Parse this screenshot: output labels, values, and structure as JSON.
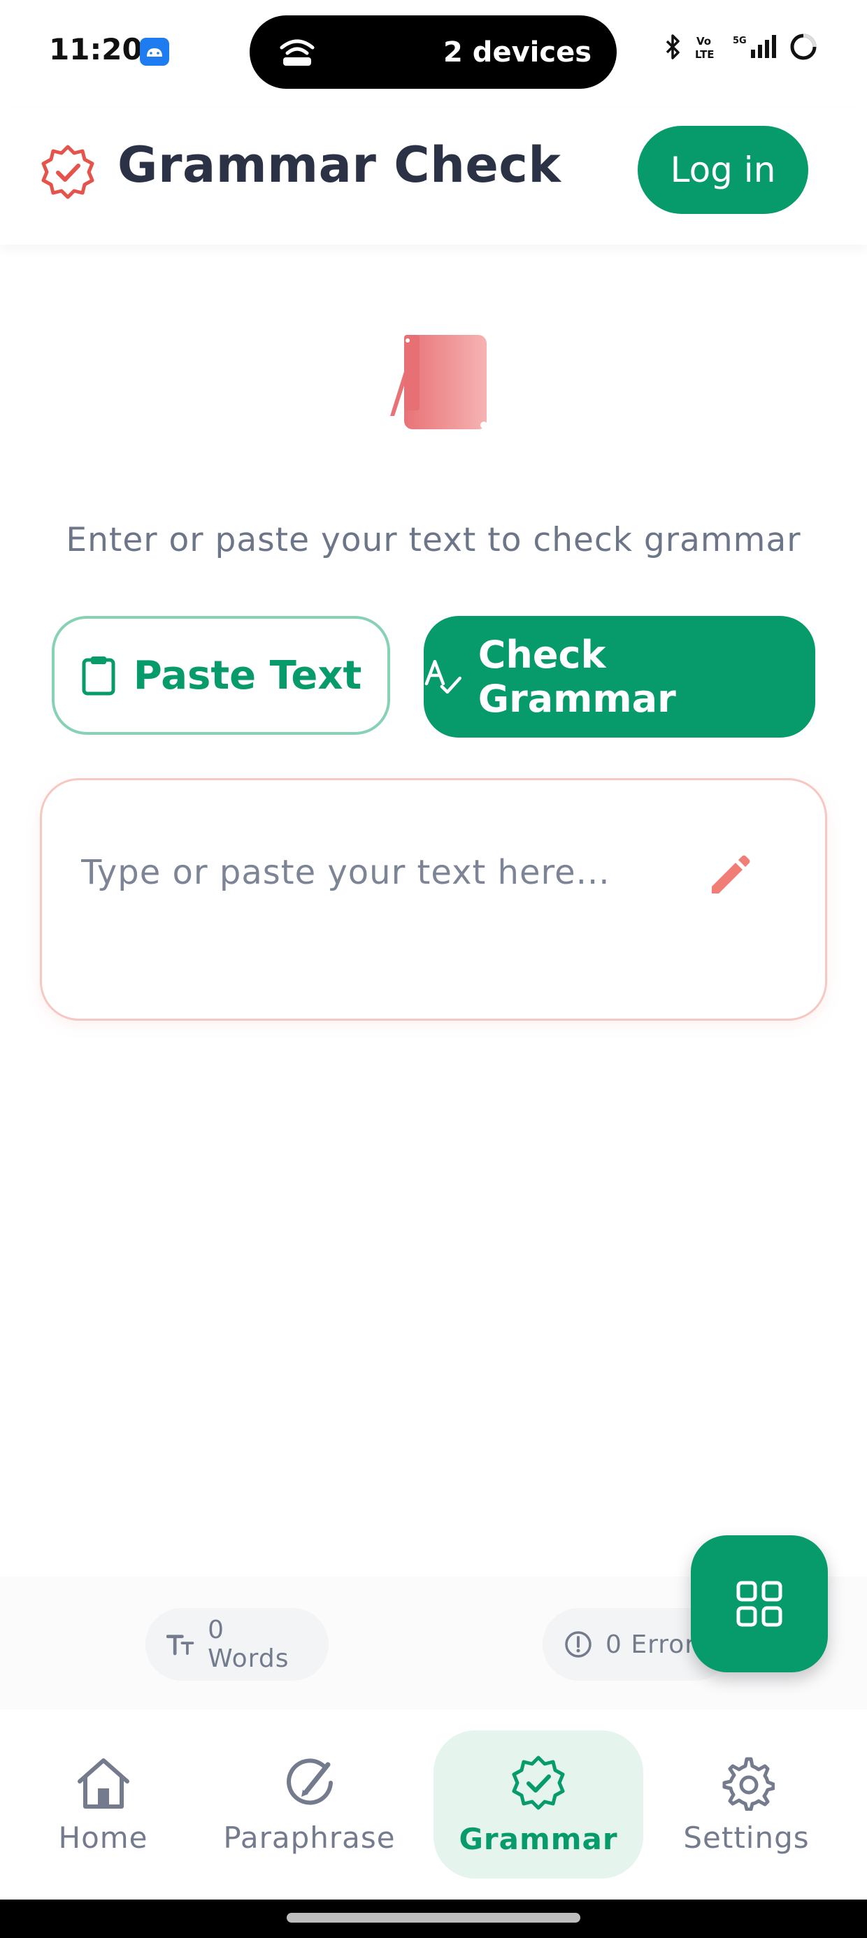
{
  "status_bar": {
    "time": "11:20",
    "island_label": "2 devices"
  },
  "header": {
    "title": "Grammar Check",
    "login_label": "Log in"
  },
  "hero": {
    "prompt": "Enter or paste your text to check grammar"
  },
  "actions": {
    "paste_label": "Paste Text",
    "check_label": "Check Grammar"
  },
  "editor": {
    "placeholder": "Type or paste your text here...",
    "value": ""
  },
  "stats": {
    "words_label": "0 Words",
    "errors_label": "0 Errors"
  },
  "bottom_nav": {
    "items": [
      {
        "label": "Home",
        "icon": "home-icon"
      },
      {
        "label": "Paraphrase",
        "icon": "paraphrase-icon"
      },
      {
        "label": "Grammar",
        "icon": "grammar-badge-icon",
        "active": true
      },
      {
        "label": "Settings",
        "icon": "gear-icon"
      }
    ]
  },
  "colors": {
    "brand_green": "#079a6b",
    "accent_red": "#e5534b",
    "text_dark": "#2c3246",
    "text_muted": "#737b8d"
  }
}
